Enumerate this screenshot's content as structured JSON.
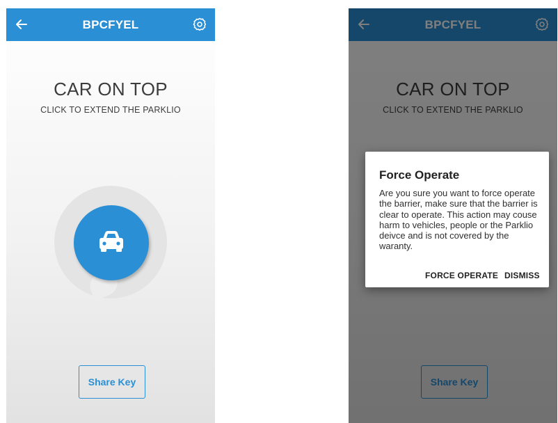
{
  "screens": [
    {
      "appbar": {
        "title": "BPCFYEL",
        "back_icon": "arrow-left-icon",
        "settings_icon": "gear-icon"
      },
      "status": {
        "title": "CAR ON TOP",
        "subtitle": "CLICK TO EXTEND THE PARKLIO"
      },
      "action_icon": "car-icon",
      "share_key_label": "Share Key"
    },
    {
      "appbar": {
        "title": "BPCFYEL",
        "back_icon": "arrow-left-icon",
        "settings_icon": "gear-icon"
      },
      "status": {
        "title": "CAR ON TOP",
        "subtitle": "CLICK TO EXTEND THE PARKLIO"
      },
      "share_key_label": "Share Key",
      "dialog": {
        "title": "Force Operate",
        "message": "Are you sure you want to force operate the barrier, make sure that the barrier is clear to operate. This action may couse harm to vehicles, people or the Parklio deivce and is not covered by the waranty.",
        "confirm_label": "FORCE OPERATE",
        "dismiss_label": "DISMISS"
      }
    }
  ],
  "colors": {
    "primary": "#2a8fd4",
    "text": "#3d3d3d",
    "scrim": "rgba(0,0,0,0.5)",
    "ring": "#e4e4e4"
  }
}
